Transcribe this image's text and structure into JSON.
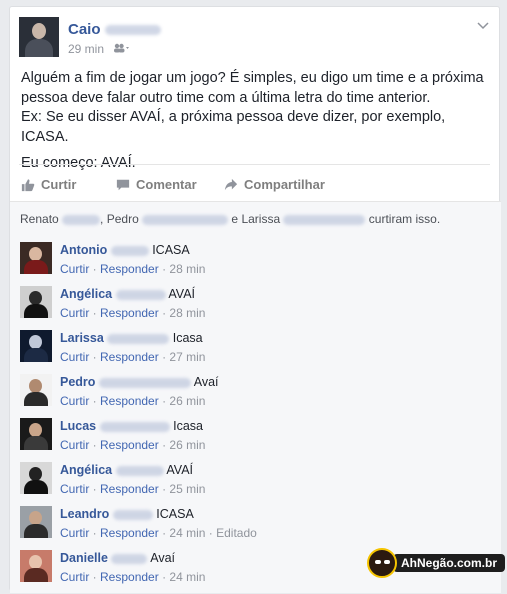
{
  "post": {
    "author_first": "Caio",
    "time": "29 min",
    "text_1": "Alguém a fim de jogar um jogo? É simples, eu digo um time e a próxima pessoa deve falar outro time com a última letra do time anterior.",
    "text_2": "Ex: Se eu disser AVAÍ, a próxima pessoa deve dizer, por exemplo, ICASA.",
    "text_3": "Eu começo: AVAÍ."
  },
  "actions": {
    "like": "Curtir",
    "comment": "Comentar",
    "share": "Compartilhar"
  },
  "likes": {
    "name_1": "Renato",
    "name_2": "Pedro",
    "name_3": "Larissa",
    "sep": ", ",
    "and": " e ",
    "suffix": " curtiram isso."
  },
  "comments": [
    {
      "name": "Antonio",
      "text": "ICASA",
      "like": "Curtir",
      "reply": "Responder",
      "time": "28 min",
      "edited": ""
    },
    {
      "name": "Angélica",
      "text": "AVAÍ",
      "like": "Curtir",
      "reply": "Responder",
      "time": "28 min",
      "edited": ""
    },
    {
      "name": "Larissa",
      "text": "Icasa",
      "like": "Curtir",
      "reply": "Responder",
      "time": "27 min",
      "edited": ""
    },
    {
      "name": "Pedro",
      "text": "Avaí",
      "like": "Curtir",
      "reply": "Responder",
      "time": "26 min",
      "edited": ""
    },
    {
      "name": "Lucas",
      "text": "Icasa",
      "like": "Curtir",
      "reply": "Responder",
      "time": "26 min",
      "edited": ""
    },
    {
      "name": "Angélica",
      "text": "AVAÍ",
      "like": "Curtir",
      "reply": "Responder",
      "time": "25 min",
      "edited": ""
    },
    {
      "name": "Leandro",
      "text": "ICASA",
      "like": "Curtir",
      "reply": "Responder",
      "time": "24 min",
      "edited": "Editado"
    },
    {
      "name": "Danielle",
      "text": "Avaí",
      "like": "Curtir",
      "reply": "Responder",
      "time": "24 min",
      "edited": ""
    }
  ],
  "watermark": "AhNegão.com.br",
  "colors": {
    "link": "#365899",
    "meta": "#90949c",
    "feedback_bg": "#f6f7f9"
  }
}
